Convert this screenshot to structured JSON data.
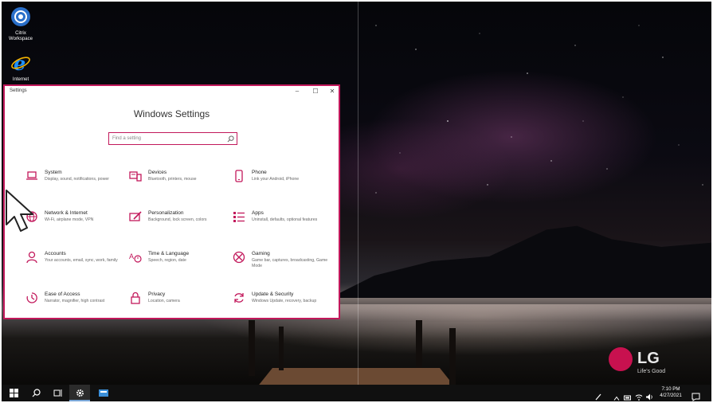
{
  "desktop": {
    "icons": [
      {
        "label_line1": "Citrix",
        "label_line2": "Workspace",
        "icon": "citrix-icon"
      },
      {
        "label_line1": "Internet",
        "icon": "internet-explorer-icon"
      }
    ],
    "brand": {
      "logo_text": "LG",
      "tagline": "Life's Good",
      "accent": "#c8114f"
    }
  },
  "settings_window": {
    "title": "Settings",
    "controls": {
      "minimize": "–",
      "maximize": "☐",
      "close": "✕"
    },
    "heading": "Windows Settings",
    "search_placeholder": "Find a setting",
    "accent": "#c2185b",
    "categories": [
      {
        "name": "System",
        "desc": "Display, sound, notifications, power",
        "icon": "laptop-icon"
      },
      {
        "name": "Devices",
        "desc": "Bluetooth, printers, mouse",
        "icon": "devices-icon"
      },
      {
        "name": "Phone",
        "desc": "Link your Android, iPhone",
        "icon": "phone-icon"
      },
      {
        "name": "Network & Internet",
        "desc": "Wi-Fi, airplane mode, VPN",
        "icon": "globe-icon"
      },
      {
        "name": "Personalization",
        "desc": "Background, lock screen, colors",
        "icon": "personalization-icon"
      },
      {
        "name": "Apps",
        "desc": "Uninstall, defaults, optional features",
        "icon": "apps-icon"
      },
      {
        "name": "Accounts",
        "desc": "Your accounts, email, sync, work, family",
        "icon": "person-icon"
      },
      {
        "name": "Time & Language",
        "desc": "Speech, region, date",
        "icon": "time-language-icon"
      },
      {
        "name": "Gaming",
        "desc": "Game bar, captures, broadcasting, Game Mode",
        "icon": "xbox-icon"
      },
      {
        "name": "Ease of Access",
        "desc": "Narrator, magnifier, high contrast",
        "icon": "ease-of-access-icon"
      },
      {
        "name": "Privacy",
        "desc": "Location, camera",
        "icon": "lock-icon"
      },
      {
        "name": "Update & Security",
        "desc": "Windows Update, recovery, backup",
        "icon": "update-icon"
      }
    ]
  },
  "taskbar": {
    "buttons": [
      "start-icon",
      "search-icon",
      "task-view-icon",
      "settings-gear-icon",
      "citrix-taskbar-icon"
    ],
    "tray": {
      "time": "7:10 PM",
      "date": "4/27/2021"
    }
  }
}
